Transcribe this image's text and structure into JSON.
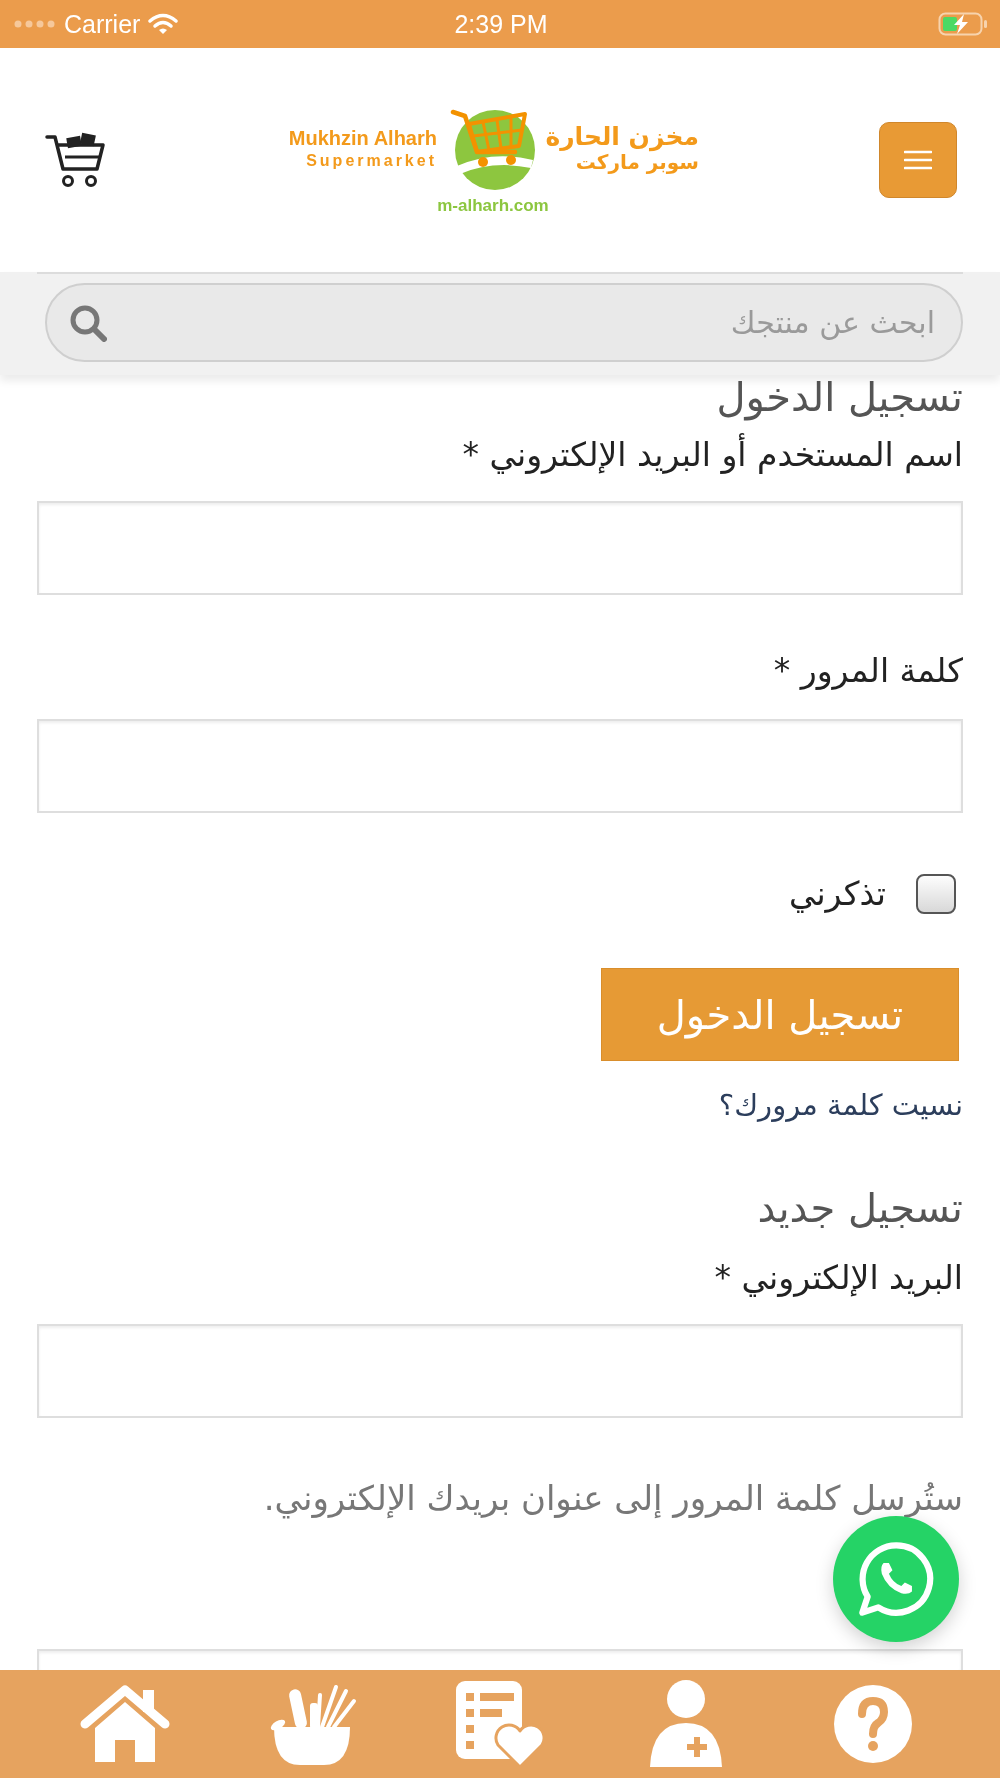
{
  "status_bar": {
    "carrier": "Carrier",
    "time": "2:39 PM"
  },
  "header": {
    "logo": {
      "name": "Mukhzin Alharh",
      "tagline": "Supermarket",
      "name_arabic": "مخزن الحارة",
      "tagline_arabic": "سوبر ماركت",
      "domain": "m-alharh.com"
    }
  },
  "search": {
    "placeholder": "ابحث عن منتجك"
  },
  "login": {
    "title": "تسجيل الدخول",
    "fields": [
      {
        "label": "اسم المستخدم أو البريد الإلكتروني *"
      },
      {
        "label": "كلمة المرور *"
      }
    ],
    "remember": {
      "label": "تذكرني",
      "checked": false
    },
    "submit": "تسجيل الدخول",
    "forgot_link": "نسيت كلمة مرورك؟"
  },
  "register": {
    "title": "تسجيل جديد",
    "fields": [
      {
        "label": "البريد الإلكتروني *"
      }
    ],
    "note": "ستُرسل كلمة المرور إلى عنوان بريدك الإلكتروني."
  }
}
